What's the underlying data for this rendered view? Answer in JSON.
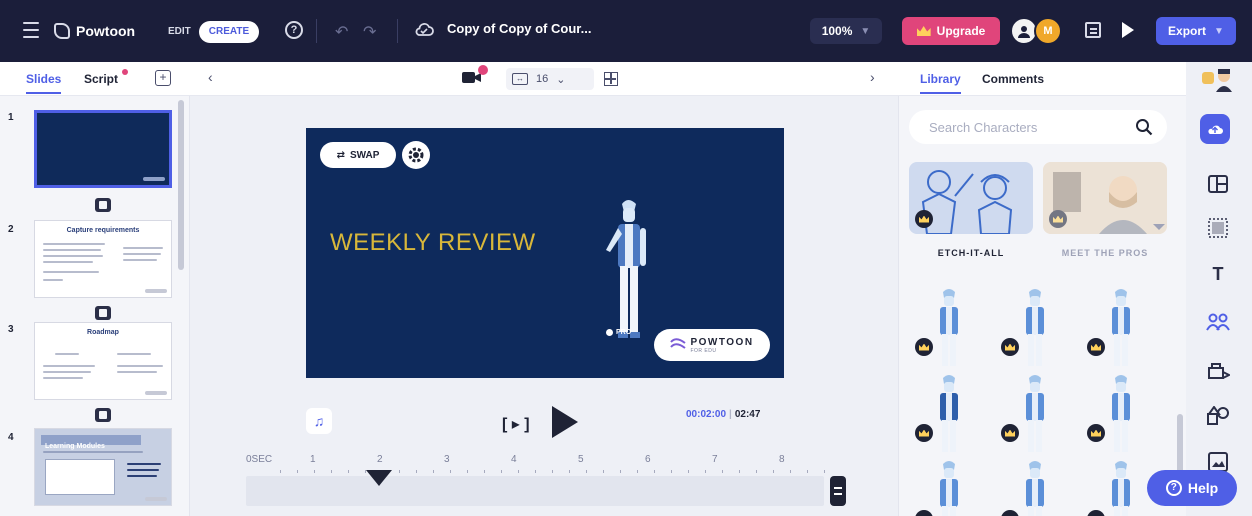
{
  "topbar": {
    "app_name": "Powtoon",
    "mode_edit": "EDIT",
    "mode_create": "CREATE",
    "help_glyph": "?",
    "undo_glyph": "↶",
    "redo_glyph": "↷",
    "title": "Copy of Copy of Cour...",
    "zoom": "100%",
    "upgrade": "Upgrade",
    "avatar_2": "M",
    "export": "Export"
  },
  "left_tabs": {
    "slides": "Slides",
    "script": "Script",
    "add_glyph": "+"
  },
  "stage_toolbar": {
    "duration_value": "16"
  },
  "slides": [
    {
      "number": "1"
    },
    {
      "number": "2",
      "title": "Capture requirements"
    },
    {
      "number": "3",
      "title": "Roadmap"
    },
    {
      "number": "4",
      "title": "Learning Modules"
    }
  ],
  "canvas": {
    "swap_label": "SWAP",
    "headline": "WEEKLY REVIEW",
    "pro_label": "PRO",
    "watermark_name": "POWTOON",
    "watermark_sub": "FOR EDU",
    "bg_color": "#0e2a5c",
    "headline_color": "#d8b73a"
  },
  "playback": {
    "preview_label": "[ ▸ ]",
    "current_time": "00:02:00",
    "separator": "|",
    "total_time": "02:47",
    "music_glyph": "♫"
  },
  "ruler": {
    "labels": [
      "0SEC",
      "1",
      "2",
      "3",
      "4",
      "5",
      "6",
      "7",
      "8"
    ],
    "playhead_at_seconds": 2
  },
  "right_tabs": {
    "library": "Library",
    "comments": "Comments"
  },
  "library": {
    "search_placeholder": "Search Characters",
    "categories": [
      {
        "label": "ETCH-IT-ALL"
      },
      {
        "label": "MEET THE PROS"
      }
    ]
  },
  "help": {
    "label": "Help",
    "glyph": "?"
  },
  "colors": {
    "topbar": "#1b1e3a",
    "accent": "#4f5fe6",
    "upgrade": "#e0457b"
  }
}
